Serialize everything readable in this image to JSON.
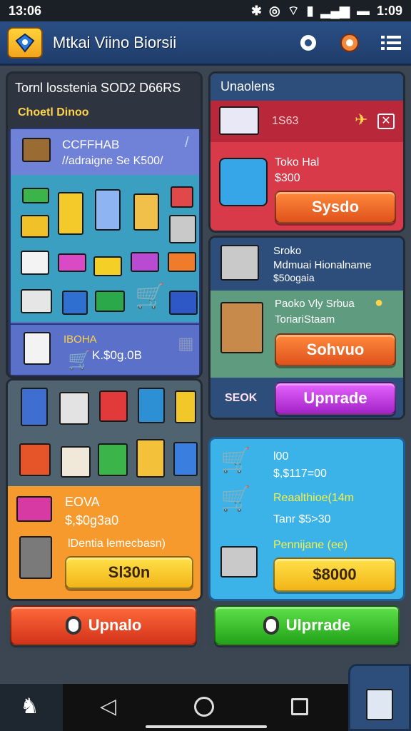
{
  "status_bar": {
    "time_left": "13:06",
    "time_right": "1:09"
  },
  "app": {
    "title": "Mtkai Viino Biorsii"
  },
  "left_top": {
    "header": "Tornl losstenia SOD2 D66RS",
    "subheader": "Choetl Dinoo",
    "shop_title": "CCFFHAB",
    "shop_sub": "//adraigne Se K500/",
    "shop_price_label": "IBOHA",
    "shop_price": "K.$0g.0B"
  },
  "left_mid": {
    "item_title": "EOVA",
    "item_price": "$,$0g3a0",
    "item_desc": "lDentia lemecbasn)",
    "button": "Sl30n"
  },
  "left_bottom": {
    "upgrade_label": "Upnalo"
  },
  "right_top": {
    "header": "Unaolens",
    "banner_code": "1S63",
    "item_title": "Toko Hal",
    "item_price": "$300",
    "button": "Sysdo"
  },
  "right_mid": {
    "l1": "Sroko",
    "l2": "Mdmuai Hionalname",
    "l3": "$50ogaia",
    "l4": "Paoko Vly Srbua",
    "l5": "ToriariStaam",
    "button1": "Sohvuo",
    "badge": "SEOK",
    "button2": "Upnrade"
  },
  "right_bottom": {
    "title": "l00",
    "price": "$,$117=00",
    "row1": "Reaalthioe(14m",
    "row2": "Tanr $5>30",
    "row3": "Pennijane (ee)",
    "button": "$8000",
    "upgrade_label": "Ulprrade"
  },
  "nav": {
    "items": [
      "back",
      "home",
      "recents"
    ]
  },
  "colors": {
    "panel_blue": "#5a70c9",
    "panel_orange": "#f79a2e",
    "panel_red": "#d83a4a",
    "panel_cyan": "#3bb3e8",
    "panel_green": "#5f9b7e"
  }
}
